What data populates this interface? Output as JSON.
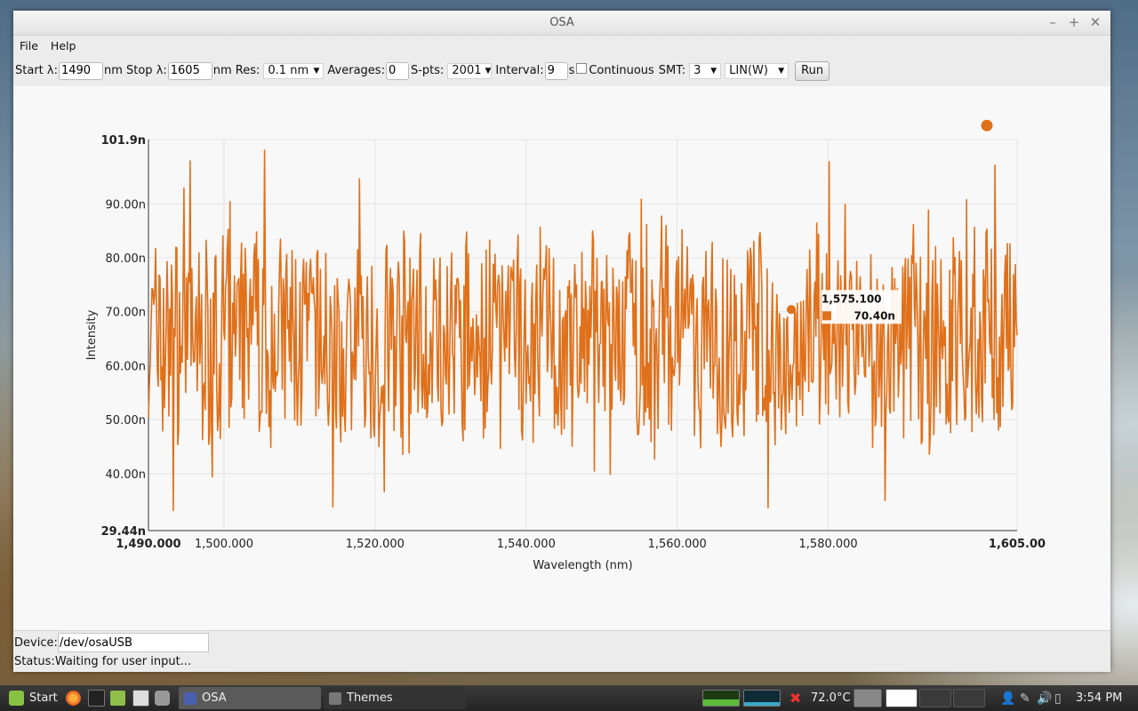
{
  "window": {
    "title": "OSA"
  },
  "menu": {
    "file": "File",
    "help": "Help"
  },
  "toolbar": {
    "start_label": "Start λ:",
    "start_value": "1490",
    "stop_label": "nm Stop λ:",
    "stop_value": "1605",
    "res_label": "nm Res:",
    "res_value": "0.1 nm",
    "averages_label": "Averages:",
    "averages_value": "0",
    "spts_label": "S-pts:",
    "spts_value": "2001",
    "interval_label": "Interval:",
    "interval_value": "9",
    "interval_unit": "s",
    "continuous_label": "Continuous",
    "smt_label": "SMT:",
    "smt_value": "3",
    "scale_value": "LIN(W)",
    "run_label": "Run"
  },
  "chart_data": {
    "type": "line",
    "xlabel": "Wavelength (nm)",
    "ylabel": "Intensity",
    "xlim": [
      1490,
      1605
    ],
    "ylim": [
      29.44,
      101.9
    ],
    "y_unit": "n",
    "color": "#e0701a",
    "grid": true,
    "x_ticks": [
      {
        "value": 1490,
        "label": "1,490.000",
        "bold": true
      },
      {
        "value": 1500,
        "label": "1,500.000"
      },
      {
        "value": 1520,
        "label": "1,520.000"
      },
      {
        "value": 1540,
        "label": "1,540.000"
      },
      {
        "value": 1560,
        "label": "1,560.000"
      },
      {
        "value": 1580,
        "label": "1,580.000"
      },
      {
        "value": 1605,
        "label": "1,605.00",
        "bold": true
      }
    ],
    "y_ticks": [
      {
        "value": 29.44,
        "label": "29.44n",
        "bold": true
      },
      {
        "value": 40,
        "label": "40.00n"
      },
      {
        "value": 50,
        "label": "50.00n"
      },
      {
        "value": 60,
        "label": "60.00n"
      },
      {
        "value": 70,
        "label": "70.00n"
      },
      {
        "value": 80,
        "label": "80.00n"
      },
      {
        "value": 90,
        "label": "90.00n"
      },
      {
        "value": 101.9,
        "label": "101.9n",
        "bold": true
      }
    ],
    "series": [
      {
        "noise": true,
        "mean": 65,
        "amplitude": 36,
        "points": 2001,
        "seed": 7
      }
    ],
    "tooltip": {
      "x": 1575.1,
      "y": 70.4,
      "x_label": "1,575.100",
      "y_label": "70.40n"
    },
    "marker": {
      "x": 1601,
      "y": 104.5
    }
  },
  "statusbar": {
    "device_label": "Device:",
    "device_value": "/dev/osaUSB",
    "status_label": "Status:",
    "status_value": "Waiting for user input..."
  },
  "taskbar": {
    "start_label": "Start",
    "window_osa": "OSA",
    "window_themes": "Themes",
    "temperature": "72.0°C",
    "clock": "3:54 PM"
  }
}
